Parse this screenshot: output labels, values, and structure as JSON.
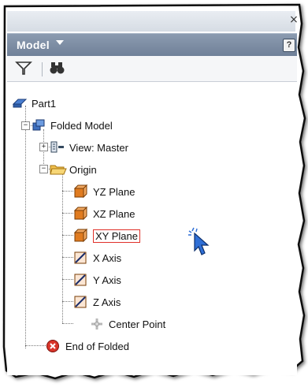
{
  "panel": {
    "title": "Model",
    "close_glyph": "×",
    "help_glyph": "?"
  },
  "toolbar": {
    "filter_icon": "filter-icon",
    "find_icon": "binoculars-icon"
  },
  "tree": {
    "root": "Part1",
    "folded_model": "Folded Model",
    "view": "View: Master",
    "origin": "Origin",
    "yz_plane": "YZ Plane",
    "xz_plane": "XZ Plane",
    "xy_plane": "XY Plane",
    "x_axis": "X Axis",
    "y_axis": "Y Axis",
    "z_axis": "Z Axis",
    "center_point": "Center Point",
    "end_of_folded": "End of Folded"
  },
  "colors": {
    "header": "#7a8aa0",
    "selection_outline": "#e0312a",
    "plane_icon": "#e07b1f",
    "cursor": "#2f6fd6"
  }
}
